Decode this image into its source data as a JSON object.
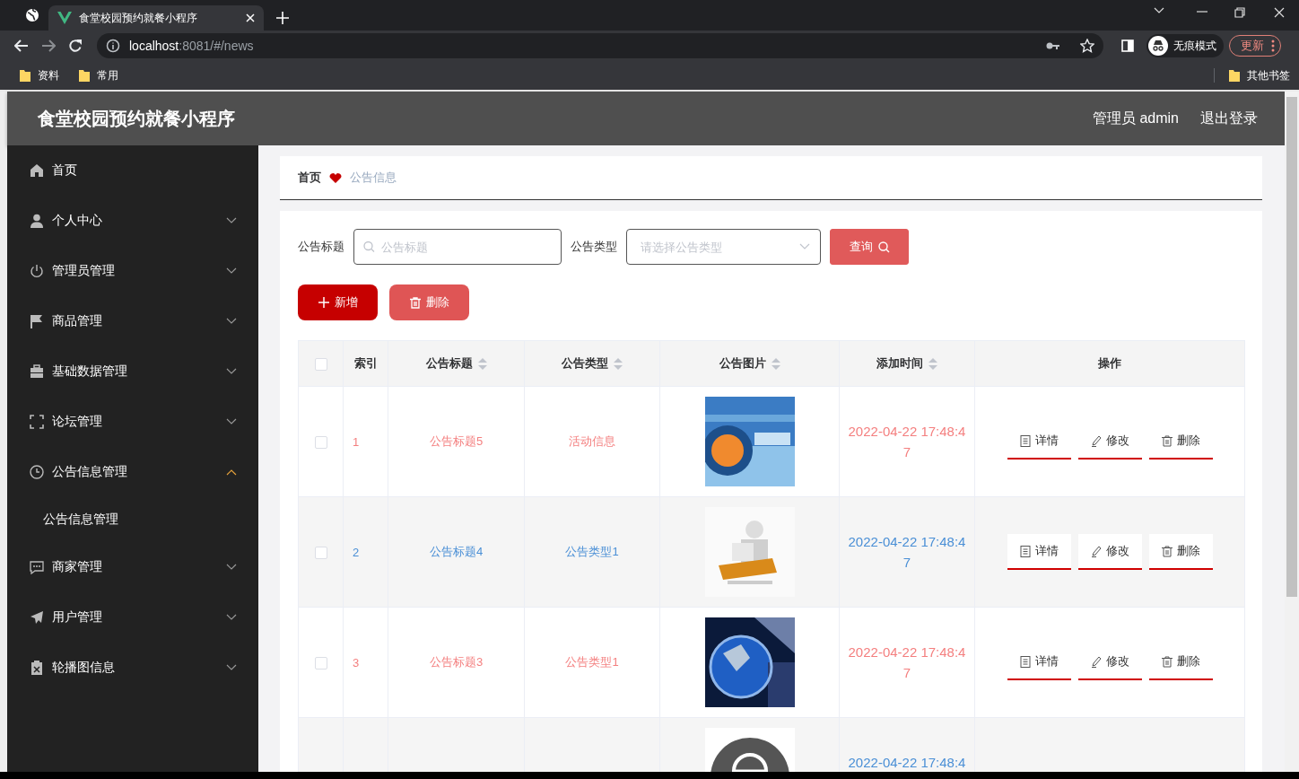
{
  "browser": {
    "tab_title": "食堂校园预约就餐小程序",
    "url_host": "localhost",
    "url_rest": ":8081/#/news",
    "profile_label": "无痕模式",
    "update_button": "更新",
    "bookmarks": [
      "资料",
      "常用"
    ],
    "other_bookmarks": "其他书签"
  },
  "header": {
    "title": "食堂校园预约就餐小程序",
    "user": "管理员 admin",
    "logout": "退出登录"
  },
  "sidebar": {
    "items": [
      {
        "label": "首页",
        "has_submenu": false,
        "expanded": false
      },
      {
        "label": "个人中心",
        "has_submenu": true,
        "expanded": false
      },
      {
        "label": "管理员管理",
        "has_submenu": true,
        "expanded": false
      },
      {
        "label": "商品管理",
        "has_submenu": true,
        "expanded": false
      },
      {
        "label": "基础数据管理",
        "has_submenu": true,
        "expanded": false
      },
      {
        "label": "论坛管理",
        "has_submenu": true,
        "expanded": false
      },
      {
        "label": "公告信息管理",
        "has_submenu": true,
        "expanded": true,
        "children": [
          {
            "label": "公告信息管理",
            "selected": false
          }
        ]
      },
      {
        "label": "商家管理",
        "has_submenu": true,
        "expanded": false
      },
      {
        "label": "用户管理",
        "has_submenu": true,
        "expanded": false
      },
      {
        "label": "轮播图信息",
        "has_submenu": true,
        "expanded": false
      }
    ]
  },
  "breadcrumb": [
    "首页",
    "公告信息"
  ],
  "search": {
    "fields": [
      {
        "kind": "text",
        "label": "公告标题",
        "placeholder": "公告标题"
      },
      {
        "kind": "select",
        "label": "公告类型",
        "placeholder": "请选择公告类型"
      }
    ],
    "query_button": "查询"
  },
  "toolbar": [
    {
      "kind": "add",
      "label": "新增"
    },
    {
      "kind": "delete",
      "label": "删除"
    }
  ],
  "table": {
    "select_all_checked": false,
    "columns": [
      {
        "kind": "plain",
        "label": "索引"
      },
      {
        "kind": "sortable",
        "label": "公告标题"
      },
      {
        "kind": "sortable",
        "label": "公告类型"
      },
      {
        "kind": "sortable",
        "label": "公告图片"
      },
      {
        "kind": "sortable",
        "label": "添加时间"
      },
      {
        "kind": "plain",
        "label": "操作"
      }
    ],
    "rows": [
      {
        "checked": false,
        "color": "#f47f7f",
        "index": "1",
        "title": "公告标题5",
        "type": "活动信息",
        "time": "2022-04-22 17:48:47",
        "actions": [
          "详情",
          "修改",
          "删除"
        ]
      },
      {
        "checked": false,
        "color": "#4a8fd6",
        "index": "2",
        "title": "公告标题4",
        "type": "公告类型1",
        "time": "2022-04-22 17:48:47",
        "actions": [
          "详情",
          "修改",
          "删除"
        ]
      },
      {
        "checked": false,
        "color": "#f47f7f",
        "index": "3",
        "title": "公告标题3",
        "type": "公告类型1",
        "time": "2022-04-22 17:48:47",
        "actions": [
          "详情",
          "修改",
          "删除"
        ]
      },
      {
        "color": "#4a8fd6",
        "time": "2022-04-22 17:48:4"
      }
    ]
  }
}
